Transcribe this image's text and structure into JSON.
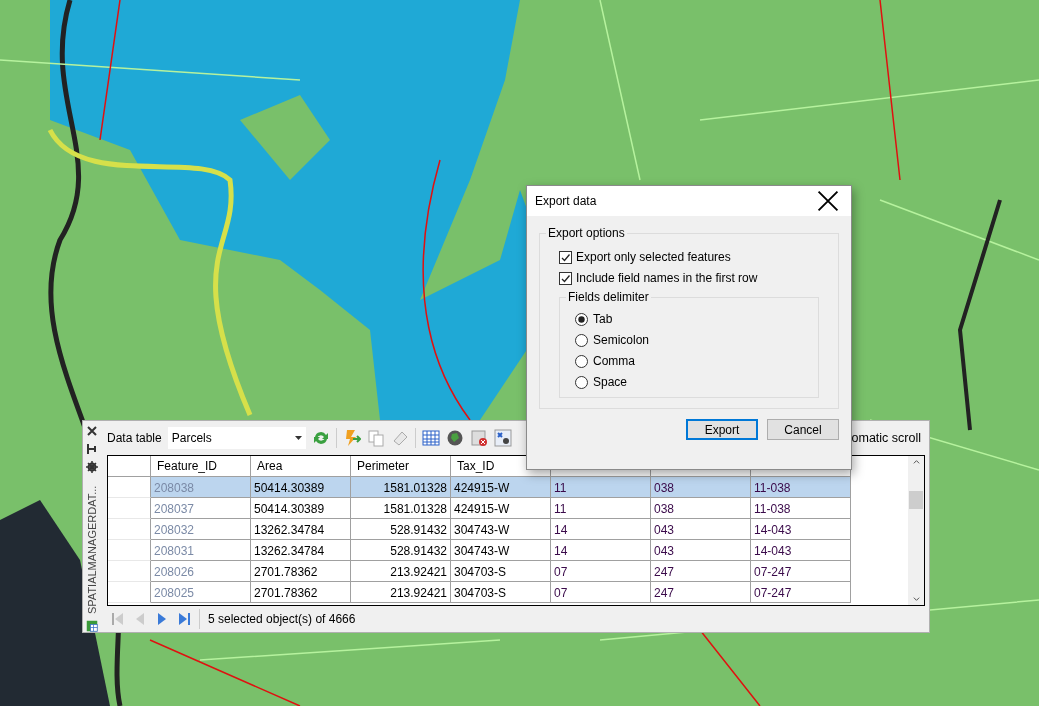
{
  "data_panel": {
    "side_title": "SPATIALMANAGERDAT...",
    "label": "Data table",
    "layer": "Parcels",
    "auto_scroll_label": "omatic scroll",
    "table": {
      "columns": [
        "Feature_ID",
        "Area",
        "Perimeter",
        "Tax_ID"
      ],
      "rows": [
        {
          "selected": true,
          "cells": [
            "208038",
            "50414.30389",
            "1581.01328",
            "424915-W",
            "11",
            "038",
            "11-038"
          ]
        },
        {
          "selected": false,
          "cells": [
            "208037",
            "50414.30389",
            "1581.01328",
            "424915-W",
            "11",
            "038",
            "11-038"
          ]
        },
        {
          "selected": false,
          "cells": [
            "208032",
            "13262.34784",
            "528.91432",
            "304743-W",
            "14",
            "043",
            "14-043"
          ]
        },
        {
          "selected": false,
          "cells": [
            "208031",
            "13262.34784",
            "528.91432",
            "304743-W",
            "14",
            "043",
            "14-043"
          ]
        },
        {
          "selected": false,
          "cells": [
            "208026",
            "2701.78362",
            "213.92421",
            "304703-S",
            "07",
            "247",
            "07-247"
          ]
        },
        {
          "selected": false,
          "cells": [
            "208025",
            "2701.78362",
            "213.92421",
            "304703-S",
            "07",
            "247",
            "07-247"
          ]
        }
      ]
    },
    "status": "5 selected object(s) of 4666"
  },
  "dialog": {
    "title": "Export data",
    "options_group": "Export options",
    "checkboxes": [
      {
        "label": "Export only selected features",
        "checked": true
      },
      {
        "label": "Include field names in the first row",
        "checked": true
      }
    ],
    "delimiter_group": "Fields delimiter",
    "delimiters": [
      {
        "label": "Tab",
        "selected": true
      },
      {
        "label": "Semicolon",
        "selected": false
      },
      {
        "label": "Comma",
        "selected": false
      },
      {
        "label": "Space",
        "selected": false
      }
    ],
    "buttons": [
      {
        "label": "Export",
        "default": true
      },
      {
        "label": "Cancel",
        "default": false
      }
    ]
  }
}
